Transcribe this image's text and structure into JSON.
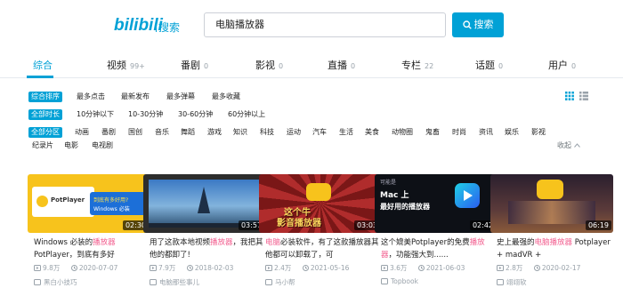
{
  "header": {
    "logo": "bilibili",
    "logo_sub": "搜索",
    "search_value": "电脑播放器",
    "search_button": "搜索"
  },
  "tabs": [
    {
      "label": "综合",
      "count": ""
    },
    {
      "label": "视频",
      "count": "99+"
    },
    {
      "label": "番剧",
      "count": "0"
    },
    {
      "label": "影视",
      "count": "0"
    },
    {
      "label": "直播",
      "count": "0"
    },
    {
      "label": "专栏",
      "count": "22"
    },
    {
      "label": "话题",
      "count": "0"
    },
    {
      "label": "用户",
      "count": "0"
    }
  ],
  "sort_options": [
    "综合排序",
    "最多点击",
    "最新发布",
    "最多弹幕",
    "最多收藏"
  ],
  "duration_options": [
    "全部时长",
    "10分钟以下",
    "10-30分钟",
    "30-60分钟",
    "60分钟以上"
  ],
  "zone_options_row1": [
    "全部分区",
    "动画",
    "番剧",
    "国创",
    "音乐",
    "舞蹈",
    "游戏",
    "知识",
    "科技",
    "运动",
    "汽车",
    "生活",
    "美食",
    "动物圈",
    "鬼畜",
    "时尚",
    "资讯",
    "娱乐",
    "影视"
  ],
  "zone_options_row2": [
    "纪录片",
    "电影",
    "电视剧"
  ],
  "collapse_label": "收起",
  "cards": [
    {
      "duration": "02:30",
      "title_pre": "Windows 必装的",
      "title_hl": "播放器",
      "title_post": " PotPlayer，到底有多好",
      "views": "9.8万",
      "date": "2020-07-07",
      "uploader": "黑白小技巧",
      "thumb_text1": "PotPlayer",
      "thumb_text2": "到底有多好用?",
      "thumb_text3": "Windows 必装"
    },
    {
      "duration": "03:57",
      "title_pre": "用了这款本地视频",
      "title_hl": "播放器",
      "title_post": "，我把其他的都卸了!",
      "views": "7.9万",
      "date": "2018-02-03",
      "uploader": "电脑那些事儿"
    },
    {
      "duration": "03:03",
      "title_pre": "",
      "title_hl": "电脑",
      "title_post": "必装软件，有了这款播放器其他都可以卸载了，可",
      "views": "2.4万",
      "date": "2021-05-16",
      "uploader": "马小帮",
      "thumb_text1": "这个牛",
      "thumb_text2": "影音播放器"
    },
    {
      "duration": "02:42",
      "title_pre": "这个媲美Potplayer的免费",
      "title_hl": "播放器",
      "title_post": "，功能强大到......",
      "views": "3.6万",
      "date": "2021-06-03",
      "uploader": "Topbook",
      "thumb_text1": "可能是",
      "thumb_text2": "Mac 上",
      "thumb_text3": "最好用的播放器"
    },
    {
      "duration": "06:19",
      "title_pre": "史上最强的",
      "title_hl": "电脑播放器",
      "title_post": " Potplayer + madVR +",
      "views": "2.8万",
      "date": "2020-02-17",
      "uploader": "翊翊软"
    }
  ],
  "colors": {
    "accent": "#00a1d6",
    "highlight": "#f25d8e",
    "muted": "#99a2aa"
  }
}
